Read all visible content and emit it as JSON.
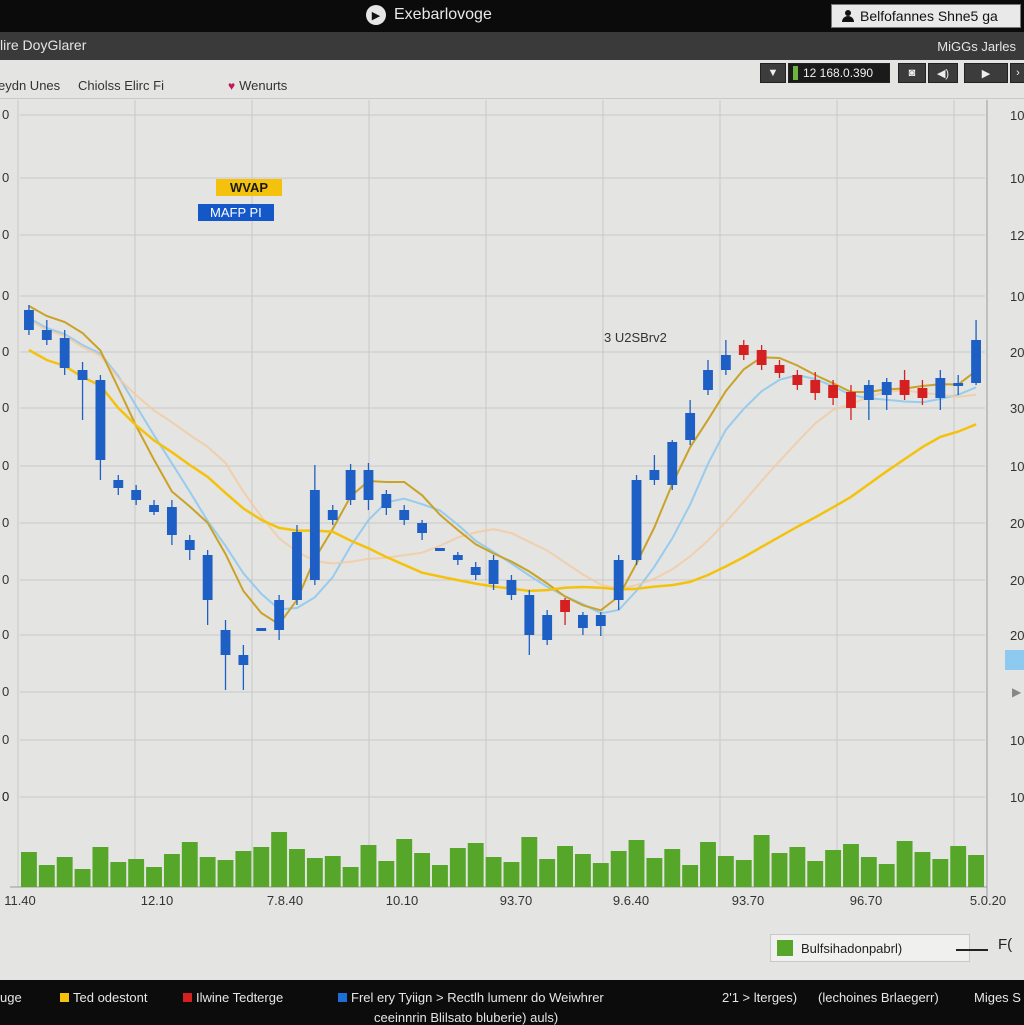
{
  "app": {
    "title": "Exebarlovoge",
    "user_label": "Belfofannes Shne5 ga"
  },
  "menubar": {
    "chart_name": "lire DoyGlarer",
    "right_label": "MiGGs Jarles"
  },
  "toolbar": {
    "legend_1": "eydn Unes",
    "legend_2": "Chiolss Elirc Fi",
    "legend_3": "Wenurts",
    "price_value": "12 168.0.390"
  },
  "labels": {
    "vwap": "WVAP",
    "mafp": "MAFP PI",
    "annotation": "3 U2SBrv2"
  },
  "legend_box": {
    "label": "Bulfsihadonpabrl)",
    "trail": "F("
  },
  "bottom": {
    "item_1": "uge",
    "item_2": "Ted odestont",
    "item_3": "Ilwine  Tedterge",
    "item_4": "Frel  ery Tyiign > Rectlh lumenr  do  Weiwhrer",
    "item_5": "2'1 >  lterges)",
    "item_6": "(lechoines Brlaegerr)",
    "item_7": "Miges S",
    "item_8": "ceeinnrin Blilsato bluberie) auls)"
  },
  "colors": {
    "bull": "#1d5fc4",
    "bear": "#d42020",
    "volume": "#55a629",
    "vwap": "#f4c20d",
    "ma_gold": "#c9a227",
    "ma_blue": "#8ec9ef"
  },
  "chart_data": {
    "type": "candlestick",
    "grid": true,
    "x_tick_labels": [
      "11.40",
      "12.10",
      "7.8.40",
      "10.10",
      "93.70",
      "9.6.40",
      "93.70",
      "96.70",
      "5.0.20"
    ],
    "left_axis_labels": [
      "0",
      "0",
      "0",
      "0",
      "0",
      "0",
      "0",
      "0",
      "0",
      "0",
      "0",
      "0",
      "0",
      "0"
    ],
    "right_axis_labels": [
      "10",
      "10",
      "12",
      "10",
      "20",
      "30",
      "10",
      "20",
      "20",
      "20",
      "10",
      "10"
    ],
    "candles": [
      {
        "o": 330,
        "c": 310,
        "h": 305,
        "l": 335
      },
      {
        "o": 340,
        "c": 330,
        "h": 320,
        "l": 345
      },
      {
        "o": 368,
        "c": 338,
        "h": 330,
        "l": 375
      },
      {
        "o": 380,
        "c": 370,
        "h": 362,
        "l": 420
      },
      {
        "o": 460,
        "c": 380,
        "h": 375,
        "l": 480
      },
      {
        "o": 488,
        "c": 480,
        "h": 475,
        "l": 495
      },
      {
        "o": 500,
        "c": 490,
        "h": 485,
        "l": 505
      },
      {
        "o": 512,
        "c": 505,
        "h": 500,
        "l": 515
      },
      {
        "o": 535,
        "c": 507,
        "h": 500,
        "l": 545
      },
      {
        "o": 550,
        "c": 540,
        "h": 535,
        "l": 560
      },
      {
        "o": 600,
        "c": 555,
        "h": 550,
        "l": 625
      },
      {
        "o": 655,
        "c": 630,
        "h": 620,
        "l": 690
      },
      {
        "o": 665,
        "c": 655,
        "h": 645,
        "l": 690
      },
      {
        "o": 630,
        "c": 628,
        "h": 628,
        "l": 630
      },
      {
        "o": 630,
        "c": 600,
        "h": 595,
        "l": 640
      },
      {
        "o": 600,
        "c": 532,
        "h": 525,
        "l": 605
      },
      {
        "o": 580,
        "c": 490,
        "h": 465,
        "l": 585
      },
      {
        "o": 520,
        "c": 510,
        "h": 505,
        "l": 525
      },
      {
        "o": 500,
        "c": 470,
        "h": 464,
        "l": 505
      },
      {
        "o": 500,
        "c": 470,
        "h": 463,
        "l": 510
      },
      {
        "o": 508,
        "c": 494,
        "h": 490,
        "l": 515
      },
      {
        "o": 520,
        "c": 510,
        "h": 505,
        "l": 525
      },
      {
        "o": 533,
        "c": 523,
        "h": 520,
        "l": 540
      },
      {
        "o": 550,
        "c": 548,
        "h": 548,
        "l": 550
      },
      {
        "o": 560,
        "c": 555,
        "h": 552,
        "l": 565
      },
      {
        "o": 575,
        "c": 567,
        "h": 562,
        "l": 580
      },
      {
        "o": 584,
        "c": 560,
        "h": 555,
        "l": 590
      },
      {
        "o": 595,
        "c": 580,
        "h": 575,
        "l": 600
      },
      {
        "o": 635,
        "c": 595,
        "h": 590,
        "l": 655
      },
      {
        "o": 640,
        "c": 615,
        "h": 610,
        "l": 645
      },
      {
        "o": 600,
        "c": 612,
        "h": 598,
        "l": 625
      },
      {
        "o": 628,
        "c": 615,
        "h": 612,
        "l": 635
      },
      {
        "o": 626,
        "c": 615,
        "h": 612,
        "l": 636
      },
      {
        "o": 600,
        "c": 560,
        "h": 555,
        "l": 610
      },
      {
        "o": 560,
        "c": 480,
        "h": 475,
        "l": 565
      },
      {
        "o": 480,
        "c": 470,
        "h": 455,
        "l": 485
      },
      {
        "o": 485,
        "c": 442,
        "h": 440,
        "l": 490
      },
      {
        "o": 440,
        "c": 413,
        "h": 400,
        "l": 445
      },
      {
        "o": 390,
        "c": 370,
        "h": 360,
        "l": 395
      },
      {
        "o": 370,
        "c": 355,
        "h": 340,
        "l": 375
      },
      {
        "o": 345,
        "c": 355,
        "h": 340,
        "l": 360
      },
      {
        "o": 350,
        "c": 365,
        "h": 345,
        "l": 370
      },
      {
        "o": 365,
        "c": 373,
        "h": 360,
        "l": 378
      },
      {
        "o": 375,
        "c": 385,
        "h": 370,
        "l": 390
      },
      {
        "o": 380,
        "c": 393,
        "h": 372,
        "l": 400
      },
      {
        "o": 385,
        "c": 398,
        "h": 380,
        "l": 405
      },
      {
        "o": 392,
        "c": 408,
        "h": 385,
        "l": 420
      },
      {
        "o": 400,
        "c": 385,
        "h": 380,
        "l": 420
      },
      {
        "o": 395,
        "c": 382,
        "h": 378,
        "l": 410
      },
      {
        "o": 380,
        "c": 395,
        "h": 370,
        "l": 400
      },
      {
        "o": 388,
        "c": 398,
        "h": 380,
        "l": 405
      },
      {
        "o": 398,
        "c": 378,
        "h": 370,
        "l": 410
      },
      {
        "o": 385,
        "c": 383,
        "h": 375,
        "l": 395
      },
      {
        "o": 383,
        "c": 340,
        "h": 320,
        "l": 385
      }
    ],
    "volume": [
      35,
      22,
      30,
      18,
      40,
      25,
      28,
      20,
      33,
      45,
      30,
      27,
      36,
      40,
      55,
      38,
      29,
      31,
      20,
      42,
      26,
      48,
      34,
      22,
      39,
      44,
      30,
      25,
      50,
      28,
      41,
      33,
      24,
      36,
      47,
      29,
      38,
      22,
      45,
      31,
      27,
      52,
      34,
      40,
      26,
      37,
      43,
      30,
      23,
      46,
      35,
      28,
      41,
      32
    ]
  }
}
